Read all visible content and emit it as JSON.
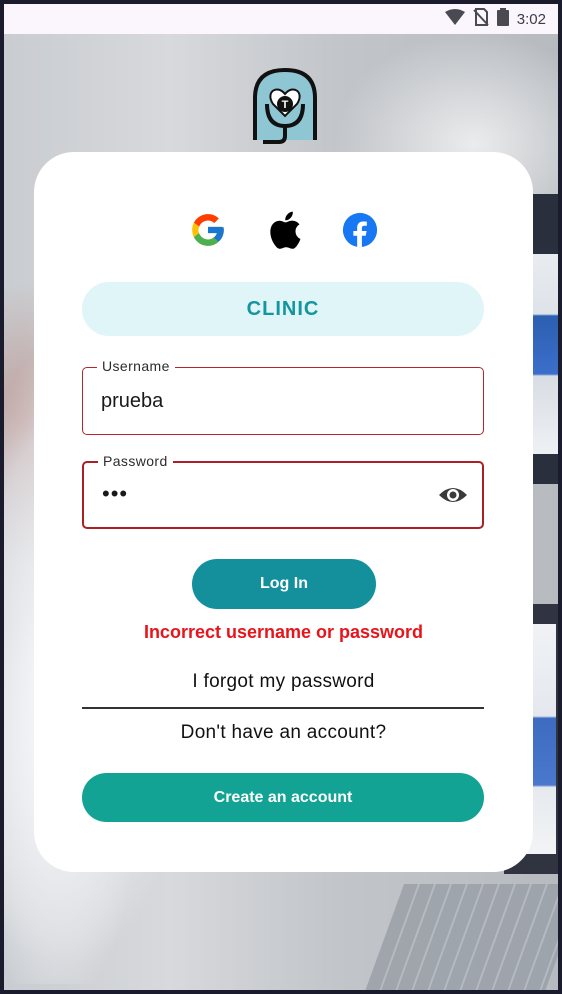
{
  "status_bar": {
    "time": "3:02",
    "icons": [
      "wifi-icon",
      "no-signal-icon",
      "battery-icon"
    ]
  },
  "logo": {
    "letter": "T"
  },
  "social": {
    "providers": [
      "google-icon",
      "apple-icon",
      "facebook-icon"
    ]
  },
  "clinic_label": "CLINIC",
  "form": {
    "username_label": "Username",
    "username_value": "prueba",
    "password_label": "Password",
    "password_value": "•••"
  },
  "login_button": "Log In",
  "error_message": "Incorrect username or password",
  "forgot_password": "I forgot my password",
  "no_account_text": "Don't have an account?",
  "create_account_button": "Create an account",
  "colors": {
    "primary": "#14909d",
    "secondary": "#12a394",
    "error": "#e8141b",
    "field_border_error": "#b3262b",
    "pill_bg": "#e0f5f7"
  }
}
